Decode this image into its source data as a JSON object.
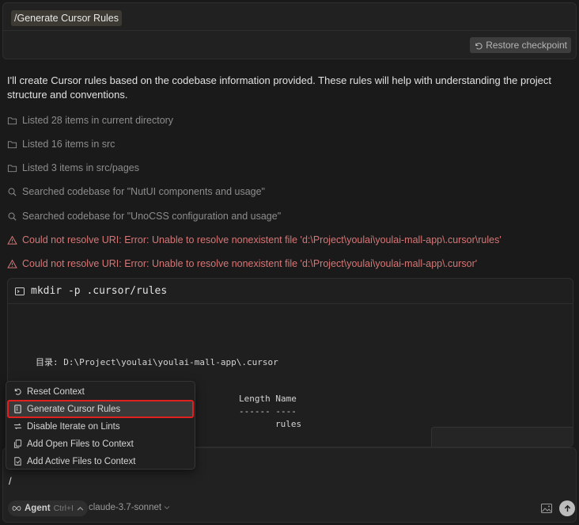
{
  "header": {
    "command_chip": "/Generate Cursor Rules",
    "restore_label": "Restore checkpoint"
  },
  "message": {
    "intro": "I'll create Cursor rules based on the codebase information provided. These rules will help with understanding the project structure and conventions."
  },
  "steps": [
    {
      "icon": "folder-icon",
      "text": "Listed 28 items in current directory",
      "status": "normal"
    },
    {
      "icon": "folder-icon",
      "text": "Listed 16 items in src",
      "status": "normal"
    },
    {
      "icon": "folder-icon",
      "text": "Listed 3 items in src/pages",
      "status": "normal"
    },
    {
      "icon": "search-icon",
      "text": "Searched codebase for \"NutUI components and usage\"",
      "status": "normal"
    },
    {
      "icon": "search-icon",
      "text": "Searched codebase for \"UnoCSS configuration and usage\"",
      "status": "normal"
    },
    {
      "icon": "warning-icon",
      "text": "Could not resolve URI: Error: Unable to resolve nonexistent file 'd:\\Project\\youlai\\youlai-mall-app\\.cursor\\rules'",
      "status": "error"
    },
    {
      "icon": "warning-icon",
      "text": "Could not resolve URI: Error: Unable to resolve nonexistent file 'd:\\Project\\youlai\\youlai-mall-app\\.cursor'",
      "status": "error"
    }
  ],
  "terminal": {
    "command": "mkdir -p .cursor/rules",
    "dir_line": "目录: D:\\Project\\youlai\\youlai-mall-app\\.cursor",
    "col_header": "Length Name",
    "col_rule": "------ ----",
    "entry": "rules"
  },
  "menu": {
    "items": [
      {
        "icon": "reset-icon",
        "label": "Reset Context"
      },
      {
        "icon": "rules-file-icon",
        "label": "Generate Cursor Rules"
      },
      {
        "icon": "iterate-icon",
        "label": "Disable Iterate on Lints"
      },
      {
        "icon": "files-icon",
        "label": "Add Open Files to Context"
      },
      {
        "icon": "active-file-icon",
        "label": "Add Active Files to Context"
      }
    ],
    "selected_index": 1
  },
  "composer": {
    "input_value": "/",
    "mode_label": "Agent",
    "mode_shortcut": "Ctrl+I",
    "model": "claude-3.7-sonnet"
  },
  "colors": {
    "background": "#1a1a1a",
    "error": "#d77676",
    "highlight_border": "#e0211f"
  }
}
